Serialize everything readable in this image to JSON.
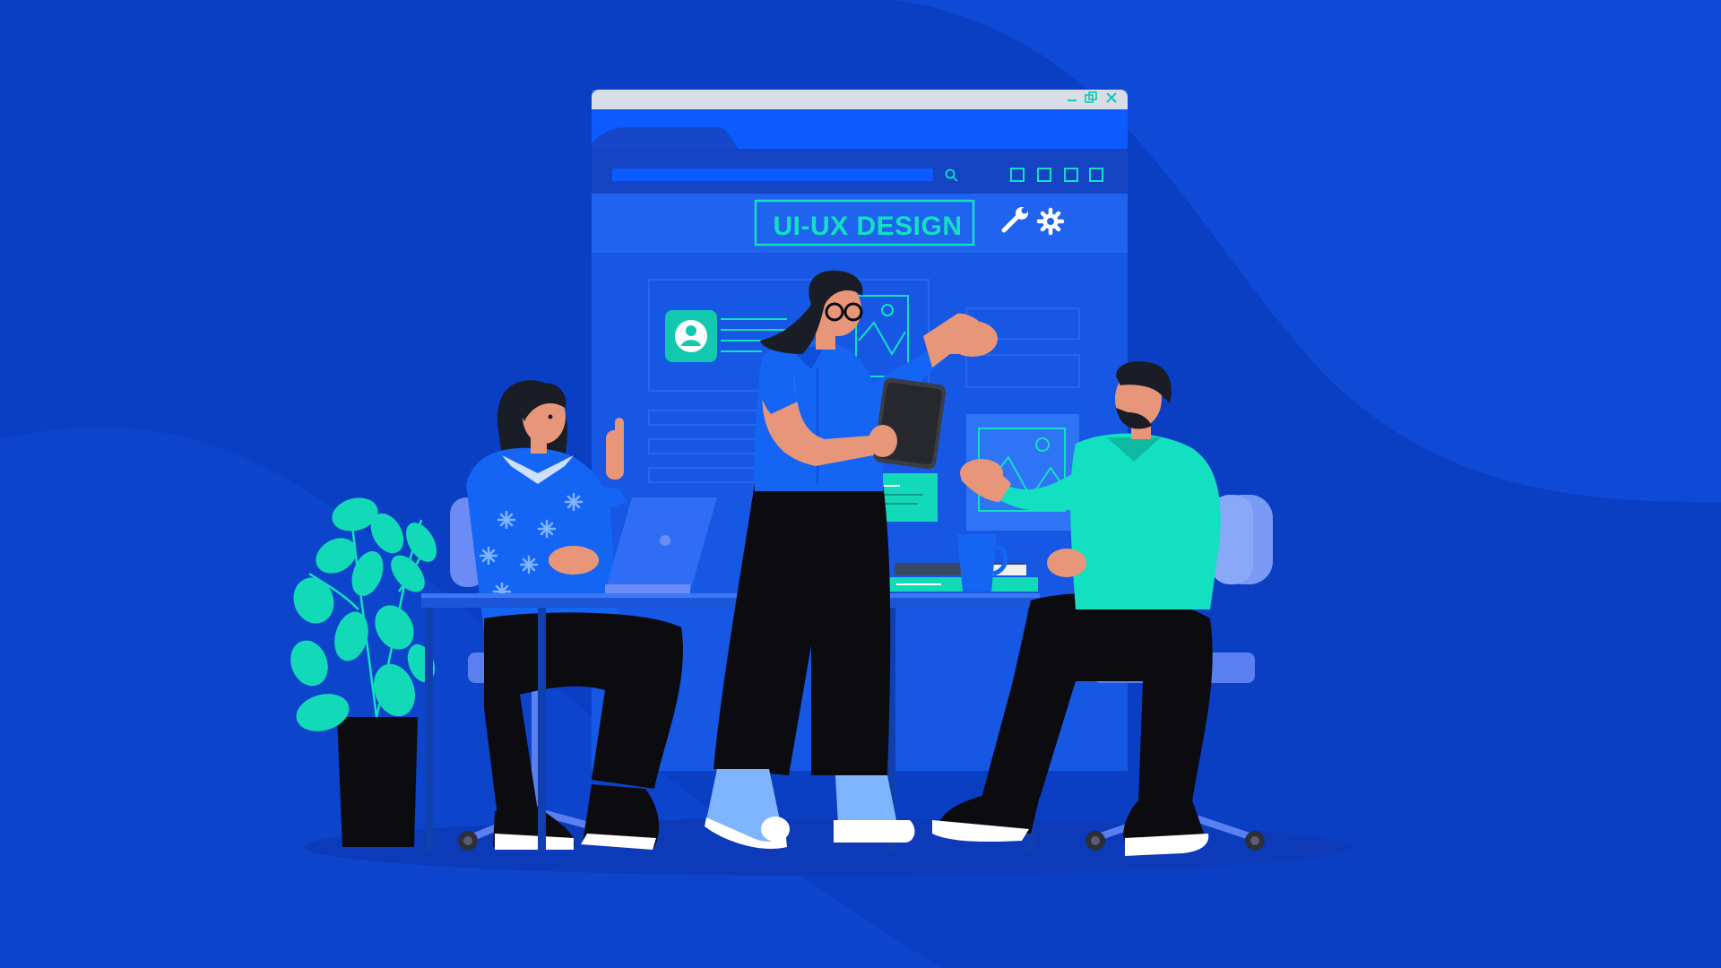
{
  "window": {
    "banner_label": "UI-UX DESIGN",
    "controls": [
      "minimize-icon",
      "restore-icon",
      "close-icon"
    ],
    "toolbar_icons": [
      "search-icon",
      "wrench-icon",
      "gear-icon"
    ]
  },
  "colors": {
    "background": "#0a3fc4",
    "background_wave": "#0e4ad6",
    "window_frame": "#1e63f0",
    "window_titlebar": "#d9dde6",
    "accent_teal": "#12e0c0",
    "shirt_blue": "#1565f5",
    "pants_black": "#0b0b10",
    "skin": "#e8967a"
  }
}
